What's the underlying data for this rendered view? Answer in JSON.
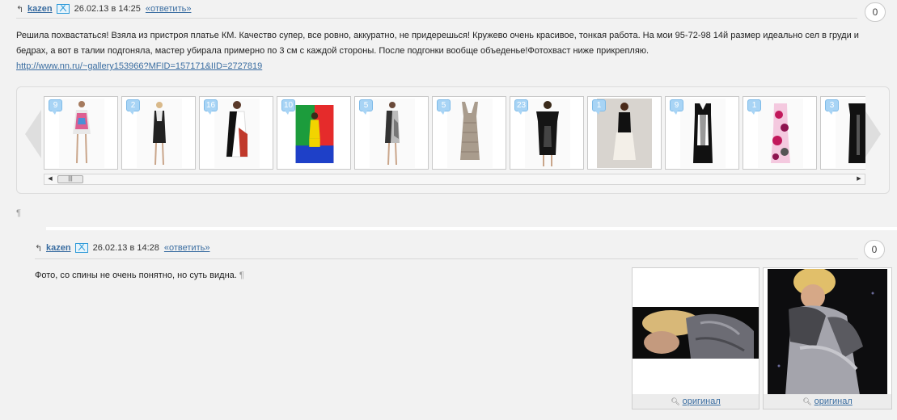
{
  "comments": [
    {
      "author": "kazen",
      "date": "26.02.13 в 14:25",
      "reply_label": "«ответить»",
      "counter": "0",
      "text_line1": "Решила похвастаться! Взяла из пристроя платье КМ. Качество супер, все ровно, аккуратно, не придерешься! Кружево очень красивое, тонкая работа. На мои 95-72-98 14й размер идеально сел в груди и",
      "text_line2": "бедрах, а вот в талии подгоняла, мастер убирала примерно по 3 см с каждой стороны. После подгонки вообще объеденье!Фотохваст ниже прикрепляю.",
      "link": "http://www.nn.ru/~gallery153966?MFID=157171&IID=2727819",
      "pilcrow": "¶"
    },
    {
      "author": "kazen",
      "date": "26.02.13 в 14:28",
      "reply_label": "«ответить»",
      "counter": "0",
      "text": "Фото, со спины не очень понятно, но суть видна.",
      "pilcrow": "¶",
      "photo_caption": "оригинал"
    }
  ],
  "gallery": {
    "badges": [
      "9",
      "2",
      "16",
      "10",
      "5",
      "5",
      "23",
      "1",
      "9",
      "1",
      "3"
    ]
  },
  "icons": {
    "reply": "reply-arrow-icon",
    "mail": "mail-icon",
    "zoom": "magnifier-icon"
  },
  "colors": {
    "link": "#3a6da1",
    "badge": "#a8d4f5",
    "background": "#f2f2f2"
  }
}
